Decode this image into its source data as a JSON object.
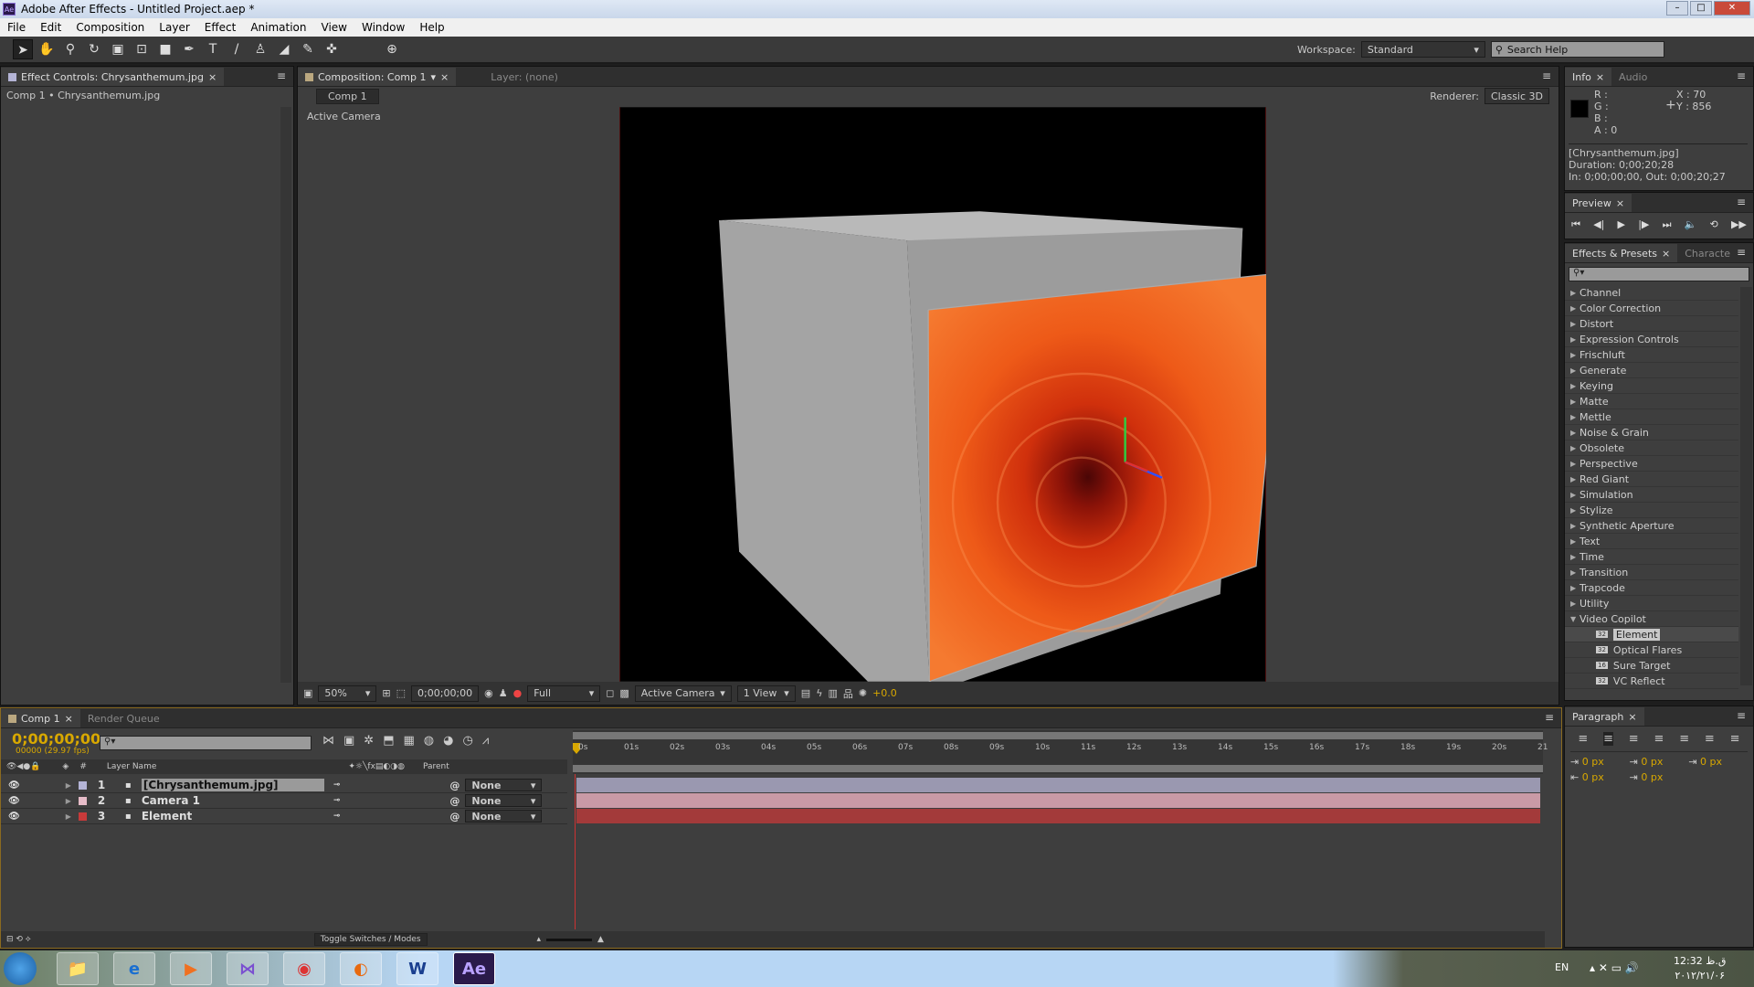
{
  "window": {
    "title": "Adobe After Effects - Untitled Project.aep *",
    "app_icon": "Ae"
  },
  "menu": [
    "File",
    "Edit",
    "Composition",
    "Layer",
    "Effect",
    "Animation",
    "View",
    "Window",
    "Help"
  ],
  "toolbar": {
    "tools": [
      "selection",
      "hand",
      "zoom",
      "rotate",
      "camera",
      "pan-behind",
      "rectangle",
      "pen",
      "type",
      "brush",
      "clone-stamp",
      "eraser",
      "roto-brush",
      "puppet-pin"
    ],
    "workspace_label": "Workspace:",
    "workspace_value": "Standard",
    "search_placeholder": "Search Help"
  },
  "effect_controls": {
    "tab": "Effect Controls: Chrysanthemum.jpg",
    "breadcrumb": "Comp 1 • Chrysanthemum.jpg"
  },
  "composition": {
    "tab": "Composition: Comp 1",
    "layer_tab": "Layer: (none)",
    "subtab": "Comp 1",
    "renderer_label": "Renderer:",
    "renderer_value": "Classic 3D",
    "view_label": "Active Camera",
    "footer": {
      "zoom": "50%",
      "timecode": "0;00;00;00",
      "resolution": "Full",
      "camera": "Active Camera",
      "views": "1 View",
      "exposure": "+0.0"
    }
  },
  "info": {
    "tabs": [
      "Info",
      "Audio"
    ],
    "r": "R :",
    "g": "G :",
    "b": "B :",
    "a": "A : 0",
    "x": "X : 70",
    "y": "Y : 856",
    "file": "[Chrysanthemum.jpg]",
    "duration": "Duration: 0;00;20;28",
    "inout": "In: 0;00;00;00, Out: 0;00;20;27"
  },
  "preview": {
    "tab": "Preview"
  },
  "effects_presets": {
    "tabs": [
      "Effects & Presets",
      "Characte"
    ],
    "categories": [
      "Channel",
      "Color Correction",
      "Distort",
      "Expression Controls",
      "Frischluft",
      "Generate",
      "Keying",
      "Matte",
      "Mettle",
      "Noise & Grain",
      "Obsolete",
      "Perspective",
      "Red Giant",
      "Simulation",
      "Stylize",
      "Synthetic Aperture",
      "Text",
      "Time",
      "Transition",
      "Trapcode",
      "Utility"
    ],
    "expanded": "Video Copilot",
    "sub_items": [
      {
        "label": "Element",
        "bits": "32",
        "selected": true
      },
      {
        "label": "Optical Flares",
        "bits": "32"
      },
      {
        "label": "Sure Target",
        "bits": "16"
      },
      {
        "label": "VC Reflect",
        "bits": "32"
      }
    ]
  },
  "paragraph": {
    "tab": "Paragraph",
    "indent_left": "0 px",
    "space_before": "0 px",
    "indent_right": "0 px",
    "indent_first": "0 px",
    "space_after": "0 px"
  },
  "timeline": {
    "tabs": [
      "Comp 1",
      "Render Queue"
    ],
    "timecode": "0;00;00;00",
    "fps": "00000 (29.97 fps)",
    "headers": {
      "num": "#",
      "name": "Layer Name",
      "parent": "Parent"
    },
    "layers": [
      {
        "num": "1",
        "name": "[Chrysanthemum.jpg]",
        "color": "#b4b4d6",
        "parent": "None",
        "bar": "#9a98b0"
      },
      {
        "num": "2",
        "name": "Camera 1",
        "color": "#e6bcc8",
        "parent": "None",
        "bar": "#c99aa6"
      },
      {
        "num": "3",
        "name": "Element",
        "color": "#c83a3a",
        "parent": "None",
        "bar": "#a33a3a"
      }
    ],
    "ruler": [
      "0s",
      "01s",
      "02s",
      "03s",
      "04s",
      "05s",
      "06s",
      "07s",
      "08s",
      "09s",
      "10s",
      "11s",
      "12s",
      "13s",
      "14s",
      "15s",
      "16s",
      "17s",
      "18s",
      "19s",
      "20s",
      "21"
    ],
    "toggle": "Toggle Switches / Modes"
  },
  "taskbar": {
    "apps": [
      "windows-explorer",
      "internet-explorer",
      "media-player",
      "visual-studio",
      "chrome",
      "firefox",
      "word",
      "after-effects"
    ],
    "lang": "EN",
    "time": "12:32 ق.ظ",
    "date": "۲۰۱۲/۲۱/۰۶"
  },
  "colors": {
    "accent": "#e8b100",
    "timecode": "#d8a800"
  }
}
